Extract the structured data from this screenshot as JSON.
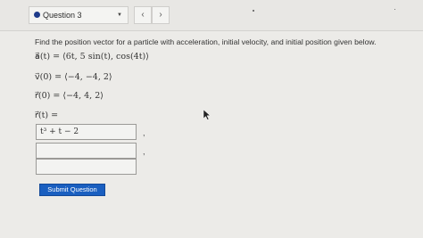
{
  "header": {
    "question_label": "Question 3",
    "prev_glyph": "‹",
    "next_glyph": "›",
    "caret_glyph": "▼",
    "status_color": "#1f3b8a"
  },
  "problem": {
    "prompt": "Find the position vector for a particle with acceleration, initial velocity, and initial position given below.",
    "acceleration": "a⃗(t) = ⟨6t, 5 sin(t), cos(4t)⟩",
    "initial_velocity": "v⃗(0) = ⟨−4, −4, 2⟩",
    "initial_position": "r⃗(0) = ⟨−4, 4, 2⟩",
    "position_label": "r⃗(t) ="
  },
  "answers": {
    "box1_value": "t³ + t − 2",
    "box2_value": "",
    "box3_value": "",
    "separator": ","
  },
  "submit_label": "Submit Question",
  "colors": {
    "accent": "#1a5fc0"
  }
}
